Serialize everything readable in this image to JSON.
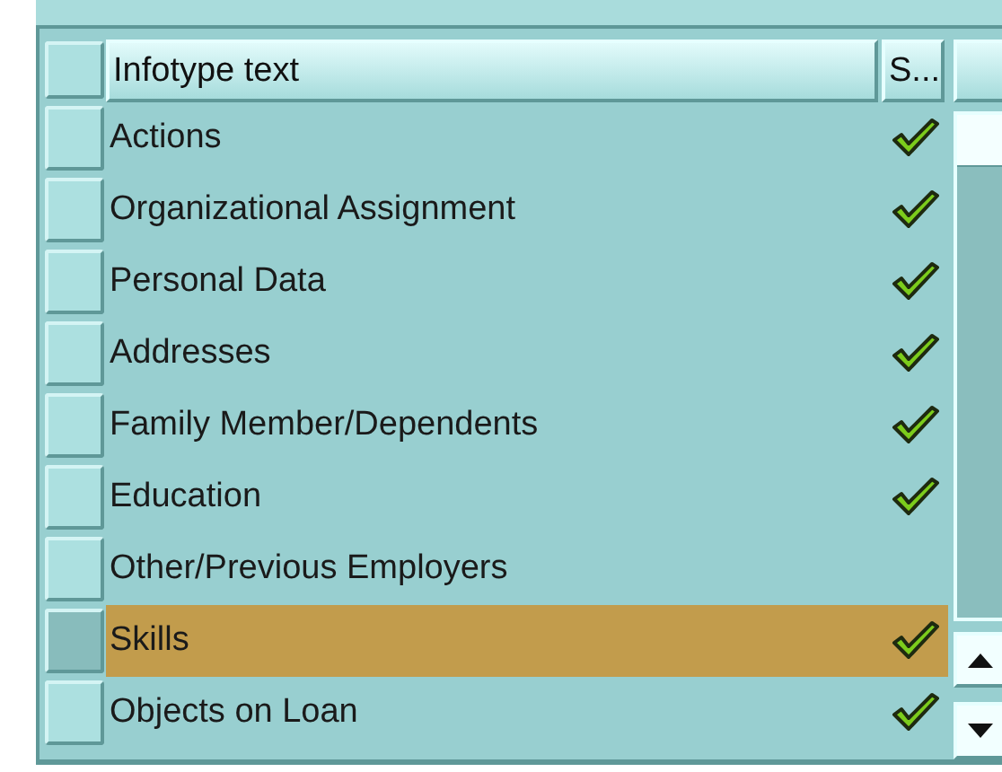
{
  "table": {
    "columns": [
      {
        "label": "Infotype text"
      },
      {
        "label": "S..."
      }
    ],
    "rows": [
      {
        "text": "Actions",
        "status": true,
        "selected": false
      },
      {
        "text": "Organizational Assignment",
        "status": true,
        "selected": false
      },
      {
        "text": "Personal Data",
        "status": true,
        "selected": false
      },
      {
        "text": "Addresses",
        "status": true,
        "selected": false
      },
      {
        "text": "Family Member/Dependents",
        "status": true,
        "selected": false
      },
      {
        "text": "Education",
        "status": true,
        "selected": false
      },
      {
        "text": "Other/Previous Employers",
        "status": false,
        "selected": false
      },
      {
        "text": "Skills",
        "status": true,
        "selected": true
      },
      {
        "text": "Objects on Loan",
        "status": true,
        "selected": false
      }
    ]
  }
}
